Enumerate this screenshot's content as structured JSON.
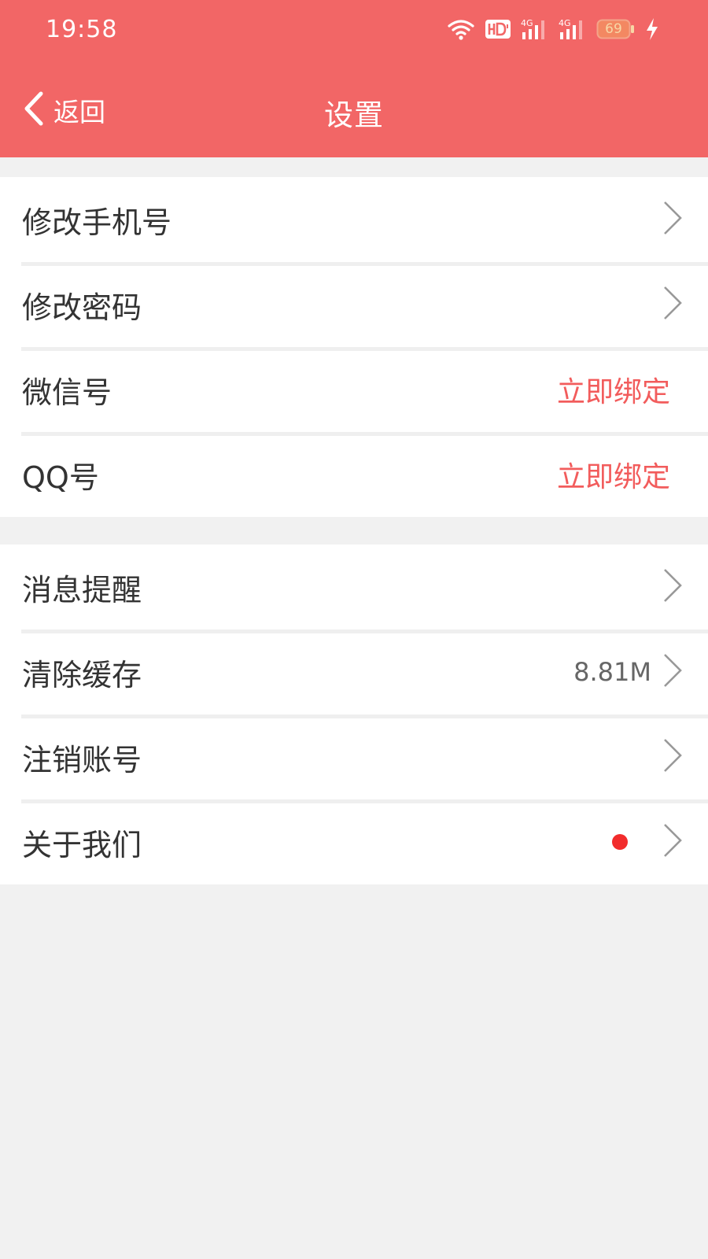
{
  "status_bar": {
    "time": "19:58",
    "battery": "69",
    "icons": [
      "wifi-icon",
      "hd-icon",
      "signal-4g-icon",
      "signal-4g-icon",
      "battery-icon",
      "charging-icon"
    ]
  },
  "header": {
    "back_label": "返回",
    "title": "设置"
  },
  "group1": {
    "items": [
      {
        "label": "修改手机号"
      },
      {
        "label": "修改密码"
      },
      {
        "label": "微信号",
        "action": "立即绑定"
      },
      {
        "label": "QQ号",
        "action": "立即绑定"
      }
    ]
  },
  "group2": {
    "items": [
      {
        "label": "消息提醒"
      },
      {
        "label": "清除缓存",
        "value": "8.81M"
      },
      {
        "label": "注销账号"
      },
      {
        "label": "关于我们"
      }
    ]
  },
  "colors": {
    "header": "#f26666",
    "accent": "#f25c5c",
    "badge": "#f22c2c",
    "background": "#f1f1f1"
  }
}
